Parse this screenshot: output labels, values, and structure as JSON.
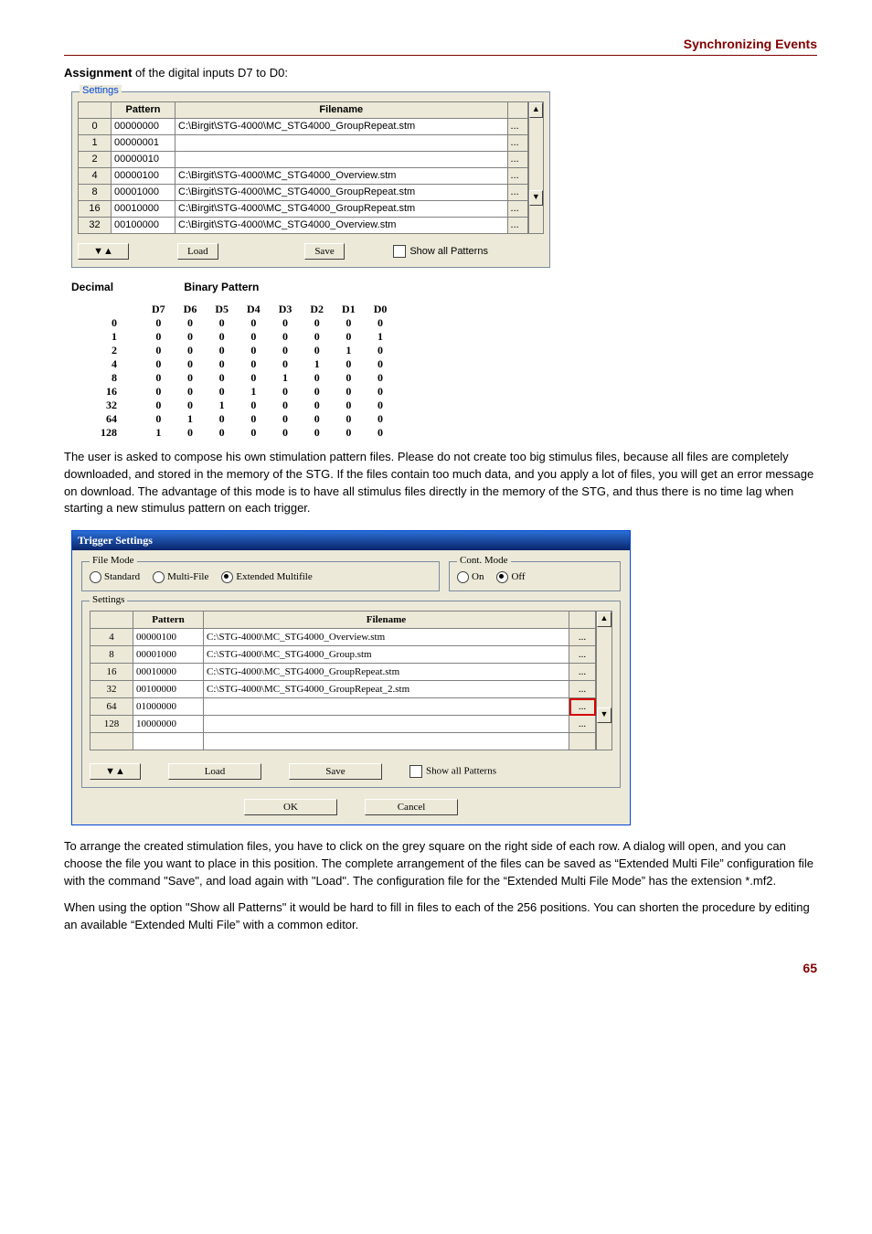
{
  "header": {
    "title": "Synchronizing Events"
  },
  "footer": {
    "page": "65"
  },
  "intro": {
    "assignment_bold": "Assignment",
    "assignment_rest": " of the digital inputs D7 to D0:"
  },
  "settings1": {
    "group_label": "Settings",
    "col_pattern": "Pattern",
    "col_filename": "Filename",
    "rows": [
      {
        "idx": "0",
        "pattern": "00000000",
        "file": "C:\\Birgit\\STG-4000\\MC_STG4000_GroupRepeat.stm"
      },
      {
        "idx": "1",
        "pattern": "00000001",
        "file": ""
      },
      {
        "idx": "2",
        "pattern": "00000010",
        "file": ""
      },
      {
        "idx": "4",
        "pattern": "00000100",
        "file": "C:\\Birgit\\STG-4000\\MC_STG4000_Overview.stm"
      },
      {
        "idx": "8",
        "pattern": "00001000",
        "file": "C:\\Birgit\\STG-4000\\MC_STG4000_GroupRepeat.stm"
      },
      {
        "idx": "16",
        "pattern": "00010000",
        "file": "C:\\Birgit\\STG-4000\\MC_STG4000_GroupRepeat.stm"
      },
      {
        "idx": "32",
        "pattern": "00100000",
        "file": "C:\\Birgit\\STG-4000\\MC_STG4000_Overview.stm"
      }
    ],
    "sort": "▼▲",
    "load": "Load",
    "save": "Save",
    "show_all": "Show all Patterns",
    "ellipsis": "..."
  },
  "binary": {
    "decimal_hdr": "Decimal",
    "binary_hdr": "Binary Pattern",
    "cols": [
      "D7",
      "D6",
      "D5",
      "D4",
      "D3",
      "D2",
      "D1",
      "D0"
    ],
    "rows": [
      {
        "d": "0",
        "b": [
          "0",
          "0",
          "0",
          "0",
          "0",
          "0",
          "0",
          "0"
        ]
      },
      {
        "d": "1",
        "b": [
          "0",
          "0",
          "0",
          "0",
          "0",
          "0",
          "0",
          "1"
        ]
      },
      {
        "d": "2",
        "b": [
          "0",
          "0",
          "0",
          "0",
          "0",
          "0",
          "1",
          "0"
        ]
      },
      {
        "d": "4",
        "b": [
          "0",
          "0",
          "0",
          "0",
          "0",
          "1",
          "0",
          "0"
        ]
      },
      {
        "d": "8",
        "b": [
          "0",
          "0",
          "0",
          "0",
          "1",
          "0",
          "0",
          "0"
        ]
      },
      {
        "d": "16",
        "b": [
          "0",
          "0",
          "0",
          "1",
          "0",
          "0",
          "0",
          "0"
        ]
      },
      {
        "d": "32",
        "b": [
          "0",
          "0",
          "1",
          "0",
          "0",
          "0",
          "0",
          "0"
        ]
      },
      {
        "d": "64",
        "b": [
          "0",
          "1",
          "0",
          "0",
          "0",
          "0",
          "0",
          "0"
        ]
      },
      {
        "d": "128",
        "b": [
          "1",
          "0",
          "0",
          "0",
          "0",
          "0",
          "0",
          "0"
        ]
      }
    ]
  },
  "para1": "The user is asked to compose his own stimulation pattern files. Please do not create too big stimulus files, because all files are completely downloaded, and stored in the memory of the STG. If the files contain too much data, and you apply a lot of files, you will get an error message on download. The advantage of this mode is to have all stimulus files directly in the memory of the STG, and thus there is no time lag when starting a new stimulus pattern on each trigger.",
  "dialog": {
    "title": "Trigger Settings",
    "file_mode": {
      "label": "File Mode",
      "opts": [
        "Standard",
        "Multi-File",
        "Extended Multifile"
      ],
      "selected": 2
    },
    "cont_mode": {
      "label": "Cont. Mode",
      "opts": [
        "On",
        "Off"
      ],
      "selected": 1
    },
    "settings_label": "Settings",
    "col_pattern": "Pattern",
    "col_filename": "Filename",
    "rows": [
      {
        "idx": "4",
        "pattern": "00000100",
        "file": "C:\\STG-4000\\MC_STG4000_Overview.stm",
        "hl": false
      },
      {
        "idx": "8",
        "pattern": "00001000",
        "file": "C:\\STG-4000\\MC_STG4000_Group.stm",
        "hl": false
      },
      {
        "idx": "16",
        "pattern": "00010000",
        "file": "C:\\STG-4000\\MC_STG4000_GroupRepeat.stm",
        "hl": false
      },
      {
        "idx": "32",
        "pattern": "00100000",
        "file": "C:\\STG-4000\\MC_STG4000_GroupRepeat_2.stm",
        "hl": false
      },
      {
        "idx": "64",
        "pattern": "01000000",
        "file": "",
        "hl": true
      },
      {
        "idx": "128",
        "pattern": "10000000",
        "file": "",
        "hl": false
      }
    ],
    "sort": "▼▲",
    "load": "Load",
    "save": "Save",
    "show_all": "Show all Patterns",
    "ok": "OK",
    "cancel": "Cancel",
    "ellipsis": "..."
  },
  "para2": "To arrange the created stimulation files, you have to click on the grey square on the right side of each row. A dialog will open, and you can choose the file you want to place in this position. The complete arrangement of the files can be saved as “Extended Multi File” configuration file with the command \"Save\", and load again with \"Load\". The configuration file for the “Extended Multi File Mode” has the extension *.mf2.",
  "para3": "When using the option \"Show all Patterns\" it would be hard to fill in files to each of the 256 positions. You can shorten the procedure by editing an available “Extended Multi File” with a common editor."
}
